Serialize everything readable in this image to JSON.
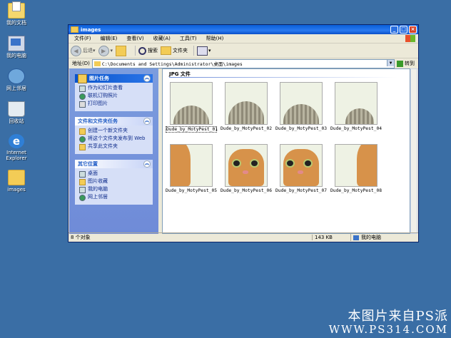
{
  "desktop": {
    "icons": [
      {
        "label": "我的文档"
      },
      {
        "label": "我的电脑"
      },
      {
        "label": "网上邻居"
      },
      {
        "label": "回收站"
      },
      {
        "label": "Internet Explorer"
      },
      {
        "label": "images"
      }
    ]
  },
  "window": {
    "title": "images",
    "controls": {
      "min": "_",
      "max": "□",
      "close": "×"
    },
    "menu": [
      "文件(F)",
      "编辑(E)",
      "查看(V)",
      "收藏(A)",
      "工具(T)",
      "帮助(H)"
    ],
    "toolbar": {
      "back": "后退",
      "search": "搜索",
      "folders": "文件夹"
    },
    "address": {
      "label": "地址(D)",
      "value": "C:\\Documents and Settings\\Administrator\\桌面\\images",
      "go": "转到"
    },
    "left_pane": {
      "panels": [
        {
          "title": "图片任务",
          "items": [
            "作为幻灯片查看",
            "联机订购照片",
            "打印图片"
          ]
        },
        {
          "title": "文件和文件夹任务",
          "items": [
            "创建一个新文件夹",
            "将这个文件夹发布到 Web",
            "共享此文件夹"
          ]
        },
        {
          "title": "其它位置",
          "items": [
            "桌面",
            "图片收藏",
            "我的电脑",
            "网上邻居"
          ]
        }
      ]
    },
    "content": {
      "group_header": "JPG 文件",
      "files": [
        {
          "name": "Dude_by_MotyPest_01"
        },
        {
          "name": "Dude_by_MotyPest_02"
        },
        {
          "name": "Dude_by_MotyPest_03"
        },
        {
          "name": "Dude_by_MotyPest_04"
        },
        {
          "name": "Dude_by_MotyPest_05"
        },
        {
          "name": "Dude_by_MotyPest_06"
        },
        {
          "name": "Dude_by_MotyPest_07"
        },
        {
          "name": "Dude_by_MotyPest_08"
        }
      ]
    },
    "status": {
      "count": "8 个对象",
      "size": "143 KB",
      "location": "我的电脑"
    }
  },
  "watermark": {
    "line1": "本图片来自PS派",
    "line2": "WWW.PS314.COM"
  }
}
